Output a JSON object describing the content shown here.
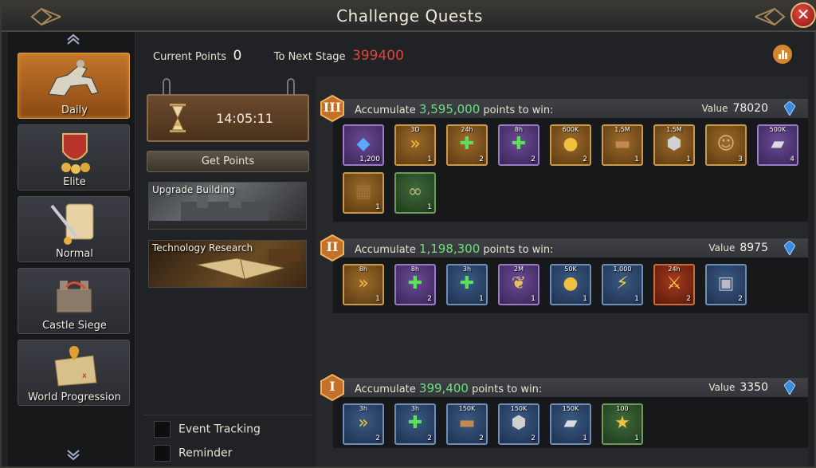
{
  "window": {
    "title": "Challenge Quests"
  },
  "header": {
    "current_points_label": "Current Points",
    "current_points_value": "0",
    "next_stage_label": "To Next Stage",
    "next_stage_value": "399400"
  },
  "sidebar": {
    "items": [
      {
        "label": "Daily",
        "icon": "knight-rider-icon",
        "active": true
      },
      {
        "label": "Elite",
        "icon": "shield-gold-icon",
        "active": false
      },
      {
        "label": "Normal",
        "icon": "scroll-sword-icon",
        "active": false
      },
      {
        "label": "Castle Siege",
        "icon": "castle-siege-icon",
        "active": false
      },
      {
        "label": "World Progression",
        "icon": "map-pin-icon",
        "active": false
      }
    ]
  },
  "timer": {
    "time": "14:05:11"
  },
  "get_points": {
    "label": "Get Points"
  },
  "tasks": [
    {
      "label": "Upgrade Building"
    },
    {
      "label": "Technology Research"
    }
  ],
  "options": {
    "event_tracking": "Event Tracking",
    "reminder": "Reminder"
  },
  "tiers": [
    {
      "roman": "III",
      "prefix": "Accumulate",
      "points": "3,595,000",
      "suffix": "points to win:",
      "value_label": "Value",
      "value": "78020",
      "items": [
        {
          "rarity": "purple",
          "icon": "gem-icon",
          "tag": "",
          "qty": "1,200"
        },
        {
          "rarity": "orange",
          "icon": "speedup-icon",
          "tag": "3D",
          "qty": "1"
        },
        {
          "rarity": "orange",
          "icon": "healing-icon",
          "tag": "24h",
          "qty": "2"
        },
        {
          "rarity": "purple",
          "icon": "healing-icon",
          "tag": "8h",
          "qty": "2"
        },
        {
          "rarity": "orange",
          "icon": "gold-coins-icon",
          "tag": "600K",
          "qty": "2"
        },
        {
          "rarity": "orange",
          "icon": "wood-icon",
          "tag": "1.5M",
          "qty": "1"
        },
        {
          "rarity": "orange",
          "icon": "stone-icon",
          "tag": "1.5M",
          "qty": "1"
        },
        {
          "rarity": "orange",
          "icon": "hero-portrait-icon",
          "tag": "",
          "qty": "3"
        },
        {
          "rarity": "purple",
          "icon": "iron-ingot-icon",
          "tag": "500K",
          "qty": "4"
        },
        {
          "rarity": "orange",
          "icon": "wood-crate-icon",
          "tag": "",
          "qty": "1"
        },
        {
          "rarity": "green",
          "icon": "rope-icon",
          "tag": "",
          "qty": "1"
        }
      ]
    },
    {
      "roman": "II",
      "prefix": "Accumulate",
      "points": "1,198,300",
      "suffix": "points to win:",
      "value_label": "Value",
      "value": "8975",
      "items": [
        {
          "rarity": "orange",
          "icon": "speedup-icon",
          "tag": "8h",
          "qty": "1"
        },
        {
          "rarity": "purple",
          "icon": "healing-icon",
          "tag": "8h",
          "qty": "2"
        },
        {
          "rarity": "blue",
          "icon": "healing-icon",
          "tag": "3h",
          "qty": "1"
        },
        {
          "rarity": "purple",
          "icon": "grain-icon",
          "tag": "2M",
          "qty": "1"
        },
        {
          "rarity": "blue",
          "icon": "gold-coins-icon",
          "tag": "50K",
          "qty": "1"
        },
        {
          "rarity": "blue",
          "icon": "lightning-icon",
          "tag": "1,000",
          "qty": "1"
        },
        {
          "rarity": "red",
          "icon": "attack-buff-icon",
          "tag": "24h",
          "qty": "2"
        },
        {
          "rarity": "blue",
          "icon": "iron-block-icon",
          "tag": "",
          "qty": "2"
        }
      ]
    },
    {
      "roman": "I",
      "prefix": "Accumulate",
      "points": "399,400",
      "suffix": "points to win:",
      "value_label": "Value",
      "value": "3350",
      "items": [
        {
          "rarity": "blue",
          "icon": "speedup-icon",
          "tag": "3h",
          "qty": "2"
        },
        {
          "rarity": "blue",
          "icon": "healing-icon",
          "tag": "3h",
          "qty": "2"
        },
        {
          "rarity": "blue",
          "icon": "wood-icon",
          "tag": "150K",
          "qty": "2"
        },
        {
          "rarity": "blue",
          "icon": "stone-icon",
          "tag": "150K",
          "qty": "2"
        },
        {
          "rarity": "blue",
          "icon": "iron-ingot-icon",
          "tag": "150K",
          "qty": "1"
        },
        {
          "rarity": "green",
          "icon": "vip-star-icon",
          "tag": "100",
          "qty": "1"
        }
      ]
    }
  ],
  "colors": {
    "accent_orange": "#d6862c",
    "points_green": "#6fe07a",
    "next_stage_red": "#e0443a"
  }
}
